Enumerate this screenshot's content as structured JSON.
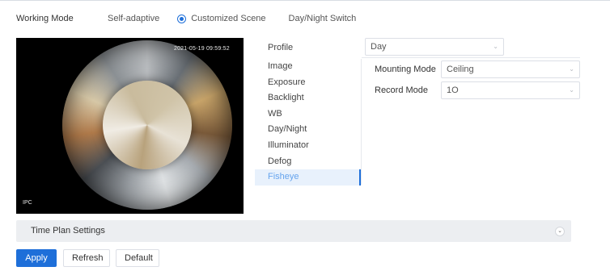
{
  "working_mode": {
    "label": "Working Mode",
    "options": [
      "Self-adaptive",
      "Customized Scene",
      "Day/Night Switch"
    ],
    "selected": "Customized Scene"
  },
  "video": {
    "timestamp": "2021-05-19 09:59:52",
    "channel_name": "IPC"
  },
  "menu": {
    "profile_label": "Profile",
    "items": [
      "Image",
      "Exposure",
      "Backlight",
      "WB",
      "Day/Night",
      "Illuminator",
      "Defog",
      "Fisheye"
    ],
    "active": "Fisheye"
  },
  "profile": {
    "value": "Day"
  },
  "fisheye": {
    "mounting_mode_label": "Mounting Mode",
    "mounting_mode_value": "Ceiling",
    "record_mode_label": "Record Mode",
    "record_mode_value": "1O"
  },
  "time_plan": {
    "label": "Time Plan Settings"
  },
  "buttons": {
    "apply": "Apply",
    "refresh": "Refresh",
    "default": "Default"
  },
  "colors": {
    "accent": "#1e6fd9",
    "active_menu_bg": "#e8f1fc",
    "active_menu_text": "#66a4ee",
    "time_plan_bg": "#eceef1"
  },
  "icons": {
    "select_chevron": "chevron-down-icon",
    "time_plan_toggle": "chevron-down-icon"
  }
}
